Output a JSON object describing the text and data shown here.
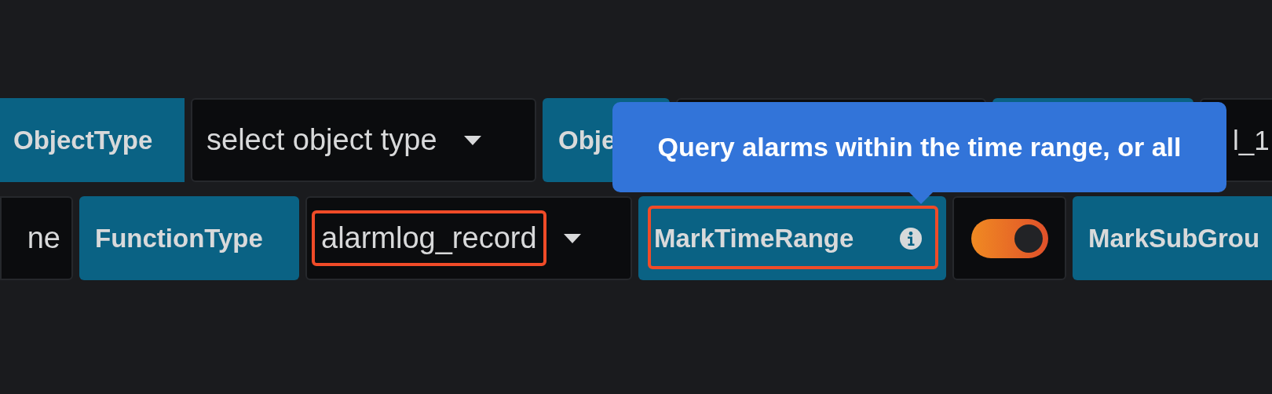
{
  "rows": [
    {
      "items": [
        {
          "kind": "label",
          "text": "ObjectType"
        },
        {
          "kind": "dropdown",
          "text": "select object type"
        },
        {
          "kind": "label",
          "text": "Obje"
        },
        {
          "kind": "dropdown"
        },
        {
          "kind": "label"
        },
        {
          "kind": "input",
          "text": "l_1"
        }
      ]
    },
    {
      "items": [
        {
          "kind": "input",
          "text": "ne"
        },
        {
          "kind": "label",
          "text": "FunctionType"
        },
        {
          "kind": "dropdown",
          "text": "alarmlog_record",
          "highlighted": true
        },
        {
          "kind": "info-label",
          "text": "MarkTimeRange",
          "highlighted": true
        },
        {
          "kind": "switch",
          "on": true
        },
        {
          "kind": "label",
          "text": "MarkSubGrou"
        }
      ]
    }
  ],
  "tooltip": {
    "text": "Query alarms within the time range, or all"
  }
}
